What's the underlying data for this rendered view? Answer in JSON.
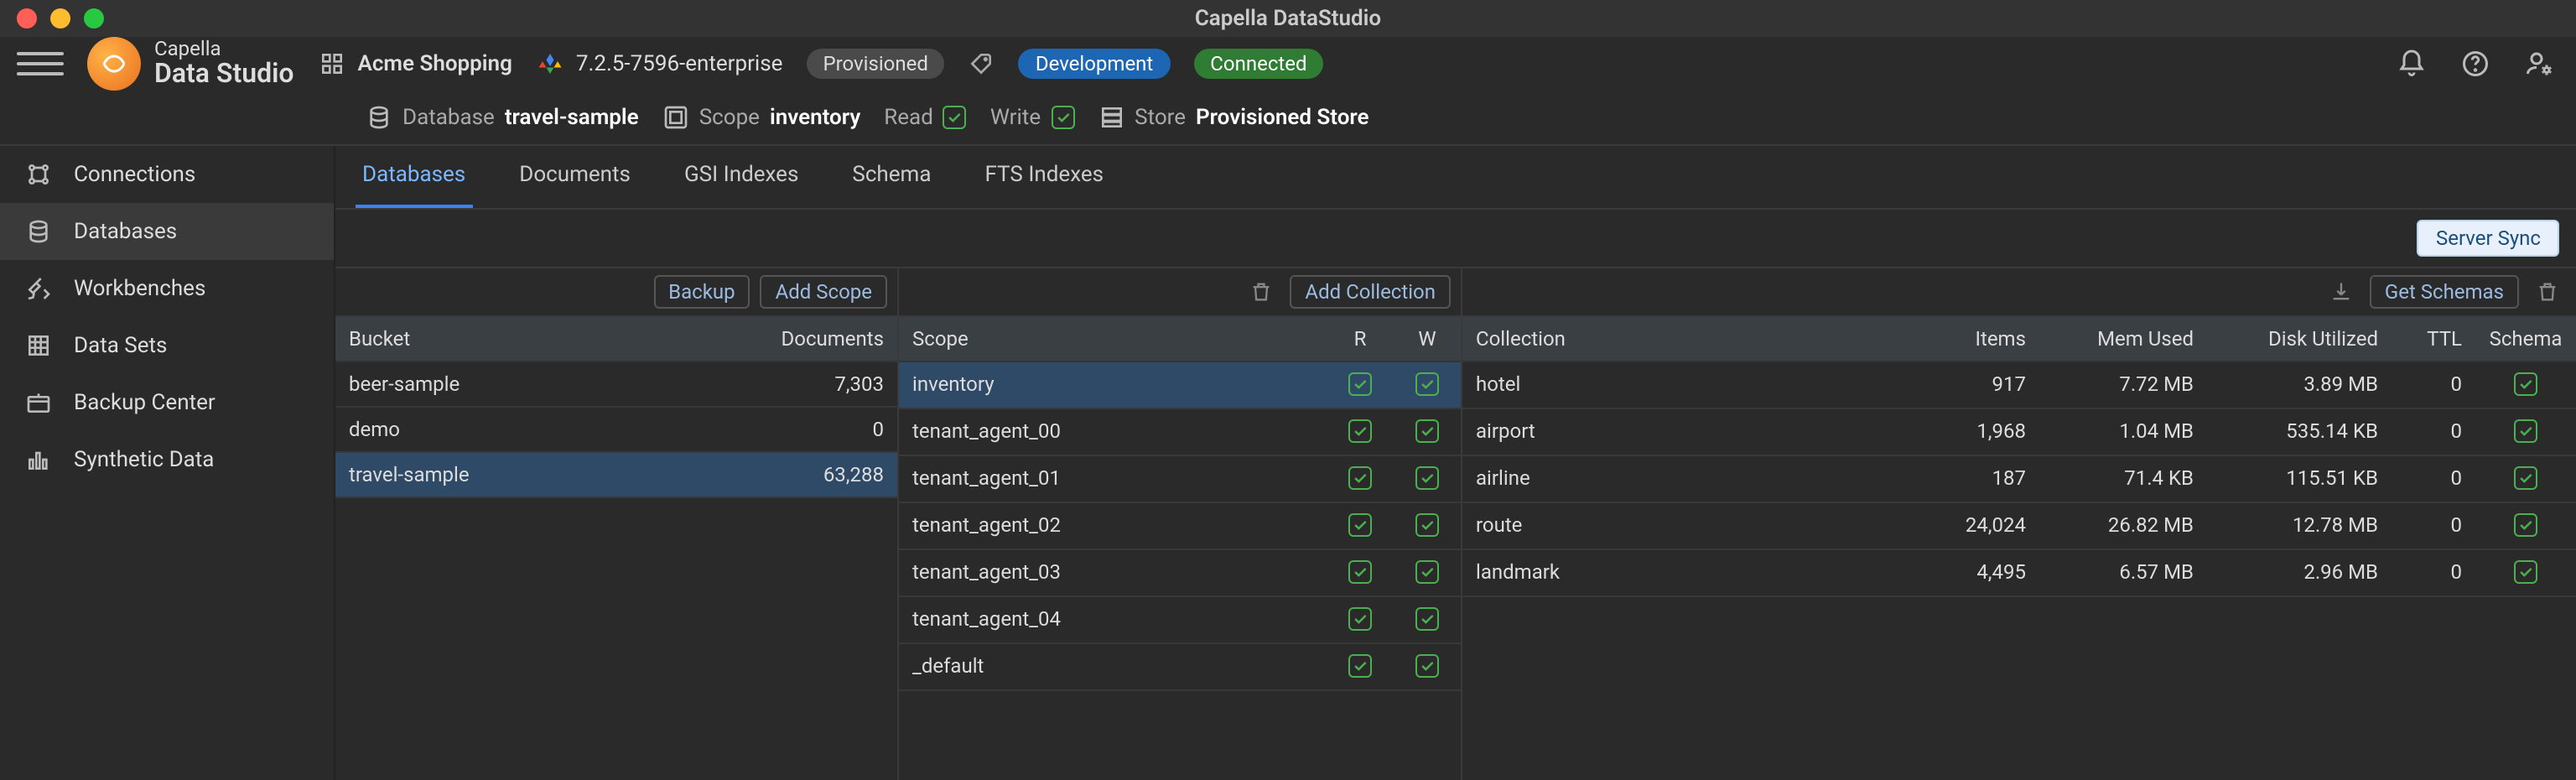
{
  "window": {
    "title": "Capella DataStudio"
  },
  "brand": {
    "line1": "Capella",
    "line2": "Data Studio"
  },
  "header": {
    "org": "Acme Shopping",
    "version": "7.2.5-7596-enterprise",
    "provisioned": "Provisioned",
    "env": "Development",
    "status": "Connected",
    "database_label": "Database",
    "database": "travel-sample",
    "scope_label": "Scope",
    "scope": "inventory",
    "read": "Read",
    "write": "Write",
    "store_label": "Store",
    "store": "Provisioned Store"
  },
  "sidebar": {
    "items": [
      {
        "label": "Connections"
      },
      {
        "label": "Databases"
      },
      {
        "label": "Workbenches"
      },
      {
        "label": "Data Sets"
      },
      {
        "label": "Backup Center"
      },
      {
        "label": "Synthetic Data"
      }
    ],
    "activeIndex": 1
  },
  "tabs": {
    "items": [
      "Databases",
      "Documents",
      "GSI Indexes",
      "Schema",
      "FTS Indexes"
    ],
    "activeIndex": 0
  },
  "buttons": {
    "serverSync": "Server Sync",
    "backup": "Backup",
    "addScope": "Add Scope",
    "addCollection": "Add Collection",
    "getSchemas": "Get Schemas"
  },
  "bucketTable": {
    "headers": {
      "bucket": "Bucket",
      "documents": "Documents"
    },
    "rows": [
      {
        "name": "beer-sample",
        "docs": "7,303"
      },
      {
        "name": "demo",
        "docs": "0"
      },
      {
        "name": "travel-sample",
        "docs": "63,288"
      }
    ],
    "selectedIndex": 2
  },
  "scopeTable": {
    "headers": {
      "scope": "Scope",
      "r": "R",
      "w": "W"
    },
    "rows": [
      {
        "name": "inventory"
      },
      {
        "name": "tenant_agent_00"
      },
      {
        "name": "tenant_agent_01"
      },
      {
        "name": "tenant_agent_02"
      },
      {
        "name": "tenant_agent_03"
      },
      {
        "name": "tenant_agent_04"
      },
      {
        "name": "_default"
      }
    ],
    "selectedIndex": 0
  },
  "collectionTable": {
    "headers": {
      "collection": "Collection",
      "items": "Items",
      "mem": "Mem Used",
      "disk": "Disk Utilized",
      "ttl": "TTL",
      "schema": "Schema"
    },
    "rows": [
      {
        "name": "hotel",
        "items": "917",
        "mem": "7.72 MB",
        "disk": "3.89 MB",
        "ttl": "0"
      },
      {
        "name": "airport",
        "items": "1,968",
        "mem": "1.04 MB",
        "disk": "535.14 KB",
        "ttl": "0"
      },
      {
        "name": "airline",
        "items": "187",
        "mem": "71.4 KB",
        "disk": "115.51 KB",
        "ttl": "0"
      },
      {
        "name": "route",
        "items": "24,024",
        "mem": "26.82 MB",
        "disk": "12.78 MB",
        "ttl": "0"
      },
      {
        "name": "landmark",
        "items": "4,495",
        "mem": "6.57 MB",
        "disk": "2.96 MB",
        "ttl": "0"
      }
    ]
  }
}
